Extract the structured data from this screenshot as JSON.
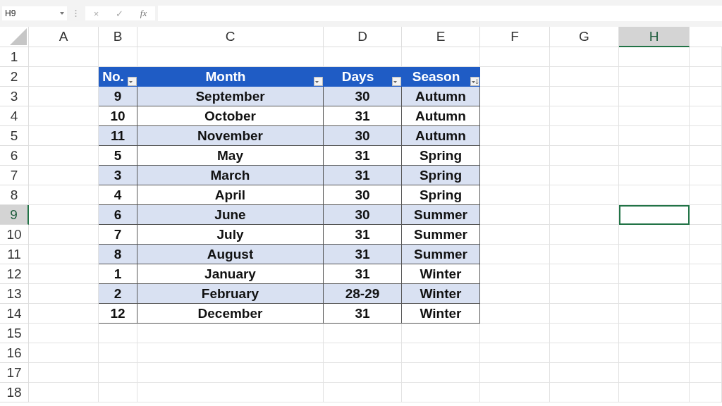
{
  "formula_bar": {
    "name_box": "H9",
    "cancel": "×",
    "enter": "✓",
    "function": "fx"
  },
  "column_headers": [
    {
      "label": "A",
      "selected": false
    },
    {
      "label": "B",
      "selected": false
    },
    {
      "label": "C",
      "selected": false
    },
    {
      "label": "D",
      "selected": false
    },
    {
      "label": "E",
      "selected": false
    },
    {
      "label": "F",
      "selected": false
    },
    {
      "label": "G",
      "selected": false
    },
    {
      "label": "H",
      "selected": true
    }
  ],
  "row_headers": [
    {
      "label": "1",
      "selected": false
    },
    {
      "label": "2",
      "selected": false
    },
    {
      "label": "3",
      "selected": false
    },
    {
      "label": "4",
      "selected": false
    },
    {
      "label": "5",
      "selected": false
    },
    {
      "label": "6",
      "selected": false
    },
    {
      "label": "7",
      "selected": false
    },
    {
      "label": "8",
      "selected": false
    },
    {
      "label": "9",
      "selected": true
    },
    {
      "label": "10",
      "selected": false
    },
    {
      "label": "11",
      "selected": false
    },
    {
      "label": "12",
      "selected": false
    },
    {
      "label": "13",
      "selected": false
    },
    {
      "label": "14",
      "selected": false
    },
    {
      "label": "15",
      "selected": false
    },
    {
      "label": "16",
      "selected": false
    },
    {
      "label": "17",
      "selected": false
    },
    {
      "label": "18",
      "selected": false
    }
  ],
  "table": {
    "columns": [
      {
        "label": "No.",
        "sorted": false
      },
      {
        "label": "Month",
        "sorted": false
      },
      {
        "label": "Days",
        "sorted": false
      },
      {
        "label": "Season",
        "sorted": true
      }
    ],
    "rows": [
      [
        "9",
        "September",
        "30",
        "Autumn"
      ],
      [
        "10",
        "October",
        "31",
        "Autumn"
      ],
      [
        "11",
        "November",
        "30",
        "Autumn"
      ],
      [
        "5",
        "May",
        "31",
        "Spring"
      ],
      [
        "3",
        "March",
        "31",
        "Spring"
      ],
      [
        "4",
        "April",
        "30",
        "Spring"
      ],
      [
        "6",
        "June",
        "30",
        "Summer"
      ],
      [
        "7",
        "July",
        "31",
        "Summer"
      ],
      [
        "8",
        "August",
        "31",
        "Summer"
      ],
      [
        "1",
        "January",
        "31",
        "Winter"
      ],
      [
        "2",
        "February",
        "28-29",
        "Winter"
      ],
      [
        "12",
        "December",
        "31",
        "Winter"
      ]
    ]
  }
}
